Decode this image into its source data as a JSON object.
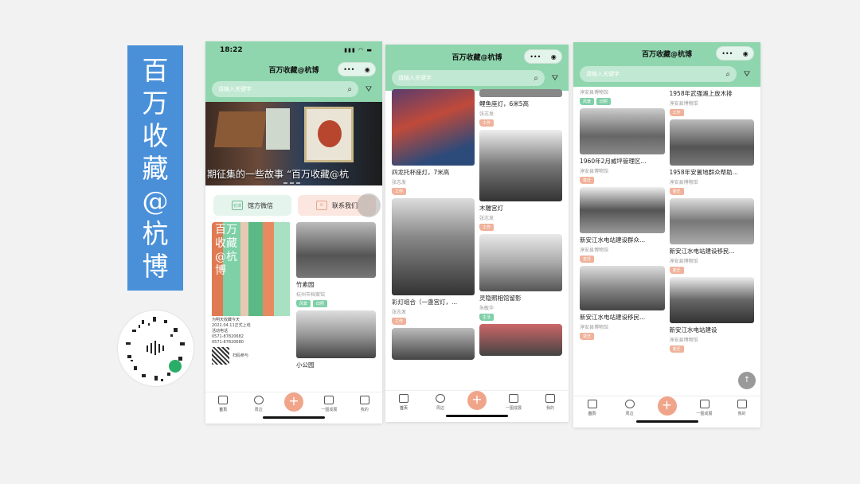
{
  "side_title": [
    "百",
    "万",
    "收",
    "藏",
    "@",
    "杭",
    "博"
  ],
  "phone1": {
    "time": "18:22",
    "signal": "▮▮▮ ◠ ▬",
    "title": "百万收藏@杭博",
    "capsule_more": "•••",
    "capsule_close": "◉",
    "search_placeholder": "请输入关键字",
    "banner_text": "期征集的一些故事 “百万收藏@杭",
    "actions": {
      "wechat": "馆方微信",
      "contact": "联系我们",
      "wechat_icon": "杭博",
      "contact_icon": "✉"
    },
    "poster": {
      "title_chars": "百万收藏@杭博",
      "line1": "为明天收藏今天",
      "line2": "2022.04.11正式上线",
      "line3": "活动电话",
      "line4": "0571-87820682",
      "line5": "0571-87820680",
      "scan": "扫码参与"
    },
    "cards": [
      {
        "title": "竹素园",
        "sub": "杭州市档案馆",
        "tags": [
          "风景",
          "旧照"
        ]
      },
      {
        "title": "小公园",
        "sub": "",
        "tags": []
      }
    ]
  },
  "phone2": {
    "title": "百万收藏@杭博",
    "search_placeholder": "请输入关键字",
    "left": [
      {
        "title": "四龙托杯座灯，7米高",
        "sub": "张志发",
        "tags": [
          "工作"
        ]
      },
      {
        "title": "彩灯组合（一盏宫灯，...",
        "sub": "张志发",
        "tags": [
          "工作"
        ]
      }
    ],
    "right": [
      {
        "title": "鲤鱼座灯，6米5高",
        "sub": "张志发",
        "tags": [
          "工作"
        ]
      },
      {
        "title": "木雕宫灯",
        "sub": "张志发",
        "tags": [
          "工作"
        ]
      },
      {
        "title": "灵隐照相馆留影",
        "sub": "朱敏华",
        "tags": [
          "生活"
        ]
      }
    ]
  },
  "phone3": {
    "title": "百万收藏@杭博",
    "search_placeholder": "请输入关键字",
    "top_left": {
      "sub": "淳安县博物馆",
      "tags": [
        "风景",
        "旧照"
      ]
    },
    "top_right": {
      "title": "1958年武强滩上放木排",
      "sub": "淳安县博物馆",
      "tags": [
        "工作"
      ]
    },
    "left": [
      {
        "title": "1960年2月威坪管理区...",
        "sub": "淳安县博物馆",
        "tags": [
          "变迁"
        ]
      },
      {
        "title": "新安江水电站建设群众...",
        "sub": "淳安县博物馆",
        "tags": [
          "变迁"
        ]
      },
      {
        "title": "新安江水电站建设移民...",
        "sub": "淳安县博物馆",
        "tags": [
          "变迁"
        ]
      }
    ],
    "right": [
      {
        "title": "1958年安置地群众帮助...",
        "sub": "淳安县博物馆",
        "tags": [
          "变迁"
        ]
      },
      {
        "title": "新安江水电站建设移民...",
        "sub": "淳安县博物馆",
        "tags": [
          "变迁"
        ]
      },
      {
        "title": "新安江水电站建设",
        "sub": "淳安县博物馆",
        "tags": [
          "变迁"
        ]
      }
    ],
    "totop": "↑"
  },
  "nav": {
    "home": "首页",
    "nearby": "周边",
    "plus": "+",
    "scan": "一图成展",
    "mine": "我的"
  },
  "colors": {
    "header": "#8fd6ae",
    "accent": "#f0a58a",
    "side": "#4a90d9"
  }
}
